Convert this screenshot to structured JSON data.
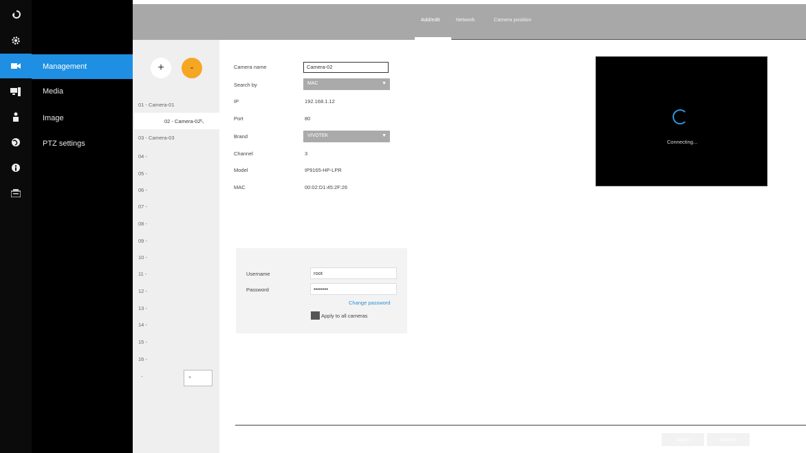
{
  "rail": {
    "icons": [
      "back-icon",
      "gear-icon",
      "camera-icon",
      "monitor-icon",
      "user-icon",
      "globe-icon",
      "info-icon",
      "stack-icon"
    ],
    "active_index": 2,
    "accent": "#1e8fe2"
  },
  "nav": {
    "items": [
      {
        "label": "Management",
        "active": true
      },
      {
        "label": "Media",
        "active": false
      },
      {
        "label": "Image",
        "active": false
      },
      {
        "label": "PTZ settings",
        "active": false
      }
    ]
  },
  "tabs": [
    {
      "label": "Add/edit",
      "active": true
    },
    {
      "label": "Network",
      "active": false
    },
    {
      "label": "Camera position",
      "active": false
    }
  ],
  "camera_list": {
    "add_label": "+",
    "remove_label": "-",
    "items": [
      "01 - Camera-01",
      "02 - Camera-02",
      "03 - Camera-03",
      "04 -",
      "05 -",
      "06 -",
      "07 -",
      "08 -",
      "09 -",
      "10 -",
      "11 -",
      "12 -",
      "13 -",
      "14 -",
      "15 -",
      "16 -"
    ],
    "selected_index": 1,
    "page_dash": "-",
    "page_value": "+"
  },
  "form": {
    "fields": [
      {
        "label": "Camera name",
        "kind": "input",
        "value": "Camera-02"
      },
      {
        "label": "Search by",
        "kind": "select",
        "value": "MAC"
      },
      {
        "label": "IP",
        "kind": "text",
        "value": "192.168.1.12"
      },
      {
        "label": "Port",
        "kind": "text",
        "value": "80"
      },
      {
        "label": "Brand",
        "kind": "select",
        "value": "VIVOTEK"
      },
      {
        "label": "Channel",
        "kind": "text",
        "value": "3"
      },
      {
        "label": "Model",
        "kind": "text",
        "value": "IP9165-HP-LPR"
      },
      {
        "label": "MAC",
        "kind": "text",
        "value": "00:02:D1:45:2F:26"
      }
    ]
  },
  "credentials": {
    "username_label": "Username",
    "username_value": "root",
    "password_label": "Password",
    "password_value": "••••••••",
    "change_password_link": "Change password",
    "apply_all_label": "Apply to all cameras"
  },
  "preview": {
    "status_text": "Connecting..."
  },
  "footer": {
    "apply_label": "Apply",
    "cancel_label": "Cancel"
  }
}
